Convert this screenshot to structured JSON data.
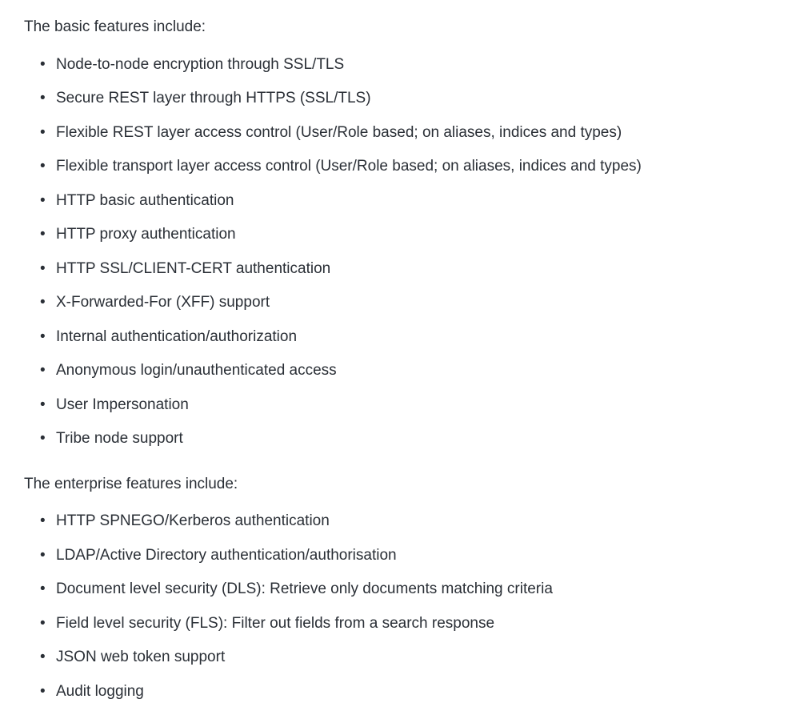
{
  "sections": [
    {
      "intro": "The basic features include:",
      "items": [
        "Node-to-node encryption through SSL/TLS",
        "Secure REST layer through HTTPS (SSL/TLS)",
        "Flexible REST layer access control (User/Role based; on aliases, indices and types)",
        "Flexible transport layer access control (User/Role based; on aliases, indices and types)",
        "HTTP basic authentication",
        "HTTP proxy authentication",
        "HTTP SSL/CLIENT-CERT authentication",
        "X-Forwarded-For (XFF) support",
        "Internal authentication/authorization",
        "Anonymous login/unauthenticated access",
        "User Impersonation",
        "Tribe node support"
      ]
    },
    {
      "intro": "The enterprise features include:",
      "items": [
        "HTTP SPNEGO/Kerberos authentication",
        "LDAP/Active Directory authentication/authorisation",
        "Document level security (DLS): Retrieve only documents matching criteria",
        "Field level security (FLS): Filter out fields from a search response",
        "JSON web token support",
        "Audit logging"
      ]
    }
  ]
}
